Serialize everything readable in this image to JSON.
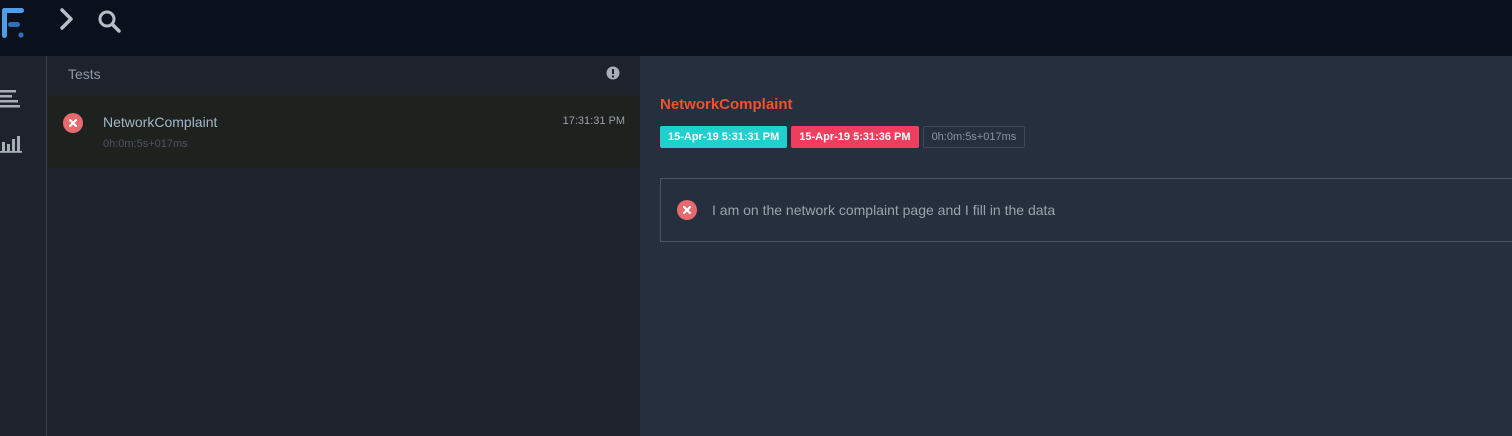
{
  "topbar": {
    "logo_icon": "extent-logo-icon",
    "nav_toggle_icon": "chevron-right-icon",
    "search_icon": "search-icon"
  },
  "rail": {
    "items": [
      {
        "icon": "list-icon"
      },
      {
        "icon": "bar-chart-icon"
      }
    ]
  },
  "tests_panel": {
    "title": "Tests",
    "info_icon": "info-icon",
    "items": [
      {
        "name": "NetworkComplaint",
        "duration": "0h:0m:5s+017ms",
        "time": "17:31:31 PM",
        "status": "fail"
      }
    ]
  },
  "detail": {
    "title": "NetworkComplaint",
    "start_time": "15-Apr-19 5:31:31 PM",
    "end_time": "15-Apr-19 5:31:36 PM",
    "duration": "0h:0m:5s+017ms",
    "steps": [
      {
        "status": "fail",
        "text": "I am on the network complaint page and I fill in the data"
      }
    ]
  },
  "colors": {
    "topbar_bg": "#0b111c",
    "panel_bg": "#1e222d",
    "detail_bg": "#252f3e",
    "title_accent": "#f0512e",
    "start_badge": "#22cfcf",
    "end_badge": "#f03e5e",
    "fail_icon": "#e8696e"
  }
}
